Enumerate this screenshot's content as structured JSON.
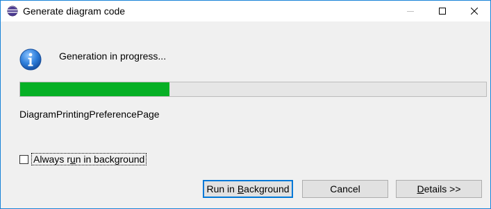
{
  "window": {
    "title": "Generate diagram code",
    "icon": "eclipse-icon",
    "controls": {
      "minimize": "minimize-icon",
      "maximize": "maximize-icon",
      "close": "close-icon"
    },
    "border_color": "#1883d7"
  },
  "dialog": {
    "icon": "info-icon",
    "message": "Generation in progress...",
    "progress": {
      "percent": 32,
      "fill_color": "#06b025"
    },
    "task_name": "DiagramPrintingPreferencePage",
    "checkbox": {
      "label_before": "Always r",
      "label_mnemonic": "u",
      "label_after": "n in background",
      "checked": false
    }
  },
  "buttons": {
    "run_background": {
      "before": "Run in ",
      "mnemonic": "B",
      "after": "ackground",
      "default": true
    },
    "cancel": {
      "label": "Cancel"
    },
    "details": {
      "mnemonic": "D",
      "after": "etails >>"
    }
  }
}
